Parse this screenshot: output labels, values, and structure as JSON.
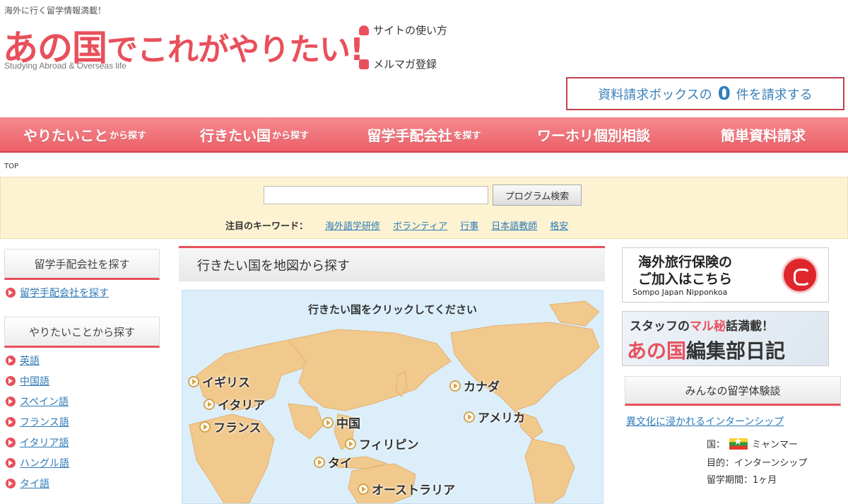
{
  "header": {
    "tagline": "海外に行く留学情報満載！",
    "logo_big": "あの国",
    "logo_rest": "でこれがやりたい!",
    "logo_sub": "Studying Abroad & Overseas life",
    "link_usage": "サイトの使い方",
    "link_mailmag": "メルマガ登録",
    "request_prefix": "資料請求ボックスの",
    "request_count": "0",
    "request_suffix": "件を請求する"
  },
  "nav": {
    "items": [
      {
        "main": "やりたいこと",
        "sub": "から探す"
      },
      {
        "main": "行きたい国",
        "sub": "から探す"
      },
      {
        "main": "留学手配会社",
        "sub": "を探す"
      },
      {
        "main": "ワーホリ個別相談",
        "sub": ""
      },
      {
        "main": "簡単資料請求",
        "sub": ""
      }
    ]
  },
  "breadcrumb": "TOP",
  "search": {
    "input_value": "",
    "button_label": "プログラム検索",
    "keyword_label": "注目のキーワード：",
    "keywords": [
      "海外語学研修",
      "ボランティア",
      "行事",
      "日本語教師",
      "格安"
    ]
  },
  "sidebar": {
    "head1": "留学手配会社を探す",
    "link1": "留学手配会社を探す",
    "head2": "やりたいことから探す",
    "items": [
      "英語",
      "中国語",
      "スペイン語",
      "フランス語",
      "イタリア語",
      "ハングル語",
      "タイ語"
    ]
  },
  "main": {
    "heading": "行きたい国を地図から探す",
    "map_title": "行きたい国をクリックしてください",
    "countries": [
      "イギリス",
      "イタリア",
      "フランス",
      "中国",
      "フィリピン",
      "タイ",
      "オーストラリア",
      "カナダ",
      "アメリカ"
    ]
  },
  "right": {
    "banner1_line1": "海外旅行保険の",
    "banner1_line2": "ご加入はこちら",
    "banner1_brand": "Sompo Japan Nipponkoa",
    "banner2_pre": "スタッフの",
    "banner2_red": "マル秘",
    "banner2_post": "話満載！",
    "banner2_big_red": "あの国",
    "banner2_big_dark": "編集部日記",
    "experience_head": "みんなの留学体験談",
    "experience_link": "異文化に浸かれるインターンシップ",
    "exp_country_label": "国：",
    "exp_country": "ミャンマー",
    "exp_purpose": "目的：インターンシップ",
    "exp_period": "留学期間：1ヶ月"
  }
}
